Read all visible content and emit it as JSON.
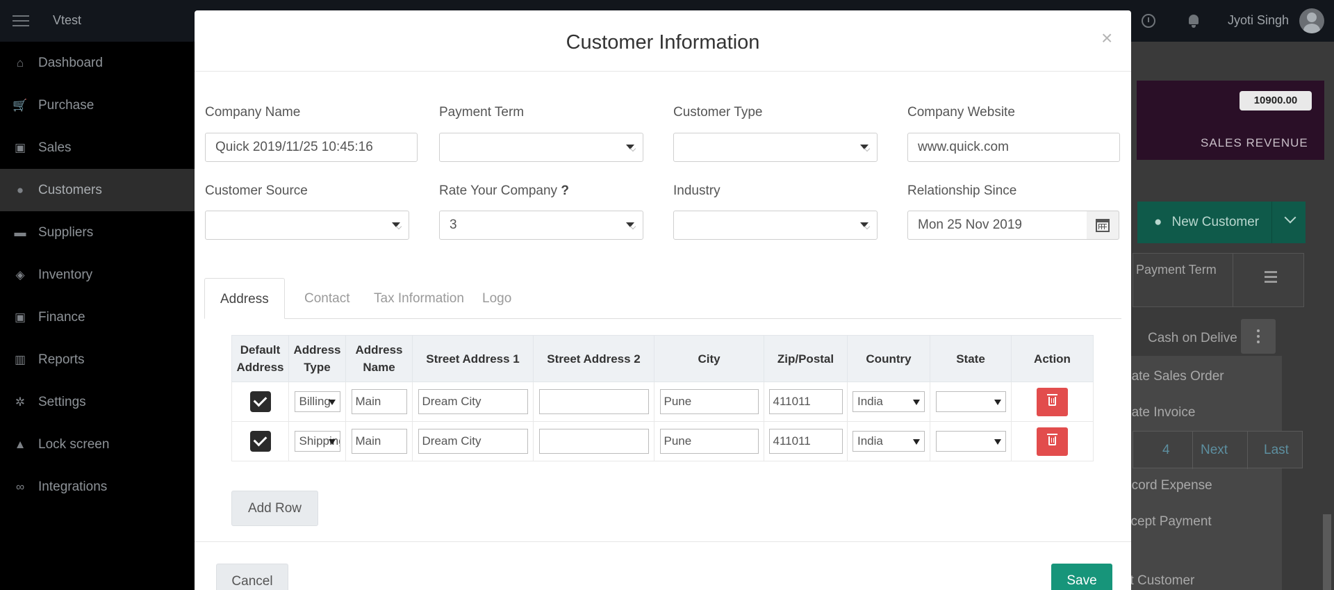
{
  "app": {
    "brand": "Vtest",
    "user_name": "Jyoti Singh"
  },
  "sidebar": {
    "items": [
      {
        "label": "Dashboard",
        "icon": "home-icon",
        "glyph": "⌂"
      },
      {
        "label": "Purchase",
        "icon": "cart-icon",
        "glyph": "🛒"
      },
      {
        "label": "Sales",
        "icon": "money-icon",
        "glyph": "▣"
      },
      {
        "label": "Customers",
        "icon": "user-icon",
        "glyph": "●",
        "active": true
      },
      {
        "label": "Suppliers",
        "icon": "truck-icon",
        "glyph": "▬"
      },
      {
        "label": "Inventory",
        "icon": "cubes-icon",
        "glyph": "◈"
      },
      {
        "label": "Finance",
        "icon": "money-icon",
        "glyph": "▣"
      },
      {
        "label": "Reports",
        "icon": "bar-chart-icon",
        "glyph": "▥"
      },
      {
        "label": "Settings",
        "icon": "gears-icon",
        "glyph": "✲"
      },
      {
        "label": "Lock screen",
        "icon": "lock-icon",
        "glyph": "▲"
      },
      {
        "label": "Integrations",
        "icon": "link-icon",
        "glyph": "∞"
      }
    ]
  },
  "background": {
    "revenue_value": "10900.00",
    "revenue_label": "SALES REVENUE",
    "new_customer_label": "New Customer",
    "payment_term_header": "Payment Term",
    "cash_text": "Cash on Delive",
    "dropdown_items": [
      "eate Sales Order",
      "eate Invoice",
      "ecord Expense",
      "ccept Payment",
      "lit Customer"
    ],
    "pager": {
      "page": "4",
      "next": "Next",
      "last": "Last"
    }
  },
  "modal": {
    "title": "Customer Information",
    "close": "×",
    "fields": {
      "company_name": {
        "label": "Company Name",
        "value": "Quick 2019/11/25 10:45:16"
      },
      "payment_term": {
        "label": "Payment Term",
        "value": ""
      },
      "customer_type": {
        "label": "Customer Type",
        "value": ""
      },
      "company_website": {
        "label": "Company Website",
        "value": "www.quick.com"
      },
      "customer_source": {
        "label": "Customer Source",
        "value": ""
      },
      "rate_company": {
        "label": "Rate Your Company",
        "help": "?",
        "value": "3"
      },
      "industry": {
        "label": "Industry",
        "value": ""
      },
      "relationship_since": {
        "label": "Relationship Since",
        "value": "Mon 25 Nov 2019"
      }
    },
    "tabs": [
      {
        "label": "Address",
        "active": true
      },
      {
        "label": "Contact"
      },
      {
        "label": "Tax Information"
      },
      {
        "label": "Logo"
      }
    ],
    "address_table": {
      "headers": [
        "Default Address",
        "Address Type",
        "Address Name",
        "Street Address 1",
        "Street Address 2",
        "City",
        "Zip/Postal",
        "Country",
        "State",
        "Action"
      ],
      "rows": [
        {
          "default": true,
          "type": "Billing",
          "name": "Main",
          "street1": "Dream City",
          "street2": "",
          "city": "Pune",
          "zip": "411011",
          "country": "India",
          "state": ""
        },
        {
          "default": true,
          "type": "Shipping",
          "name": "Main",
          "street1": "Dream City",
          "street2": "",
          "city": "Pune",
          "zip": "411011",
          "country": "India",
          "state": ""
        }
      ]
    },
    "add_row_label": "Add Row",
    "cancel_label": "Cancel",
    "save_label": "Save"
  },
  "colors": {
    "save": "#17957a",
    "delete": "#e24d4d",
    "sidebar_active": "#2d2d2d",
    "revenue_card": "#2a0f27",
    "new_customer": "#0f5a4a"
  }
}
